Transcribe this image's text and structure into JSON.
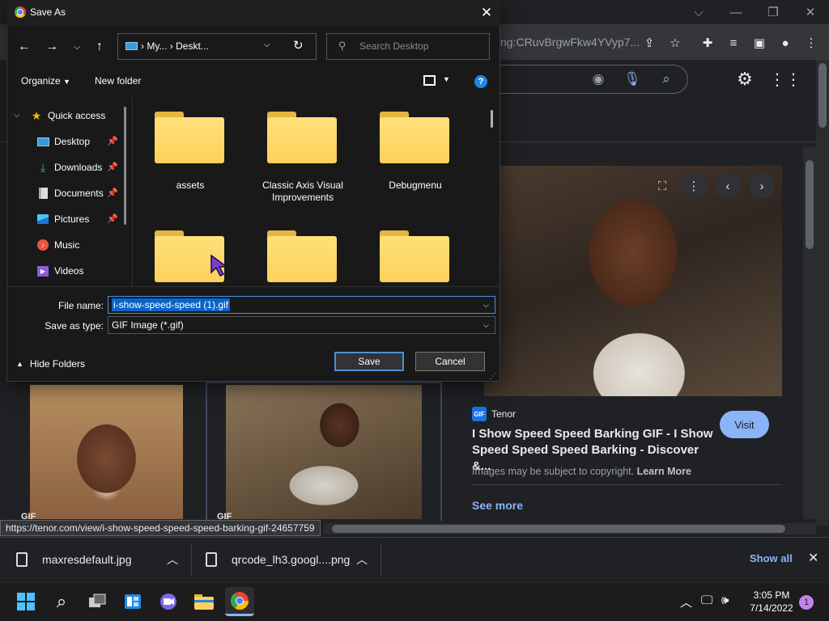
{
  "dialog": {
    "title": "Save As",
    "address_path": "My...  ›  Deskt...",
    "search_placeholder": "Search Desktop",
    "organize_label": "Organize",
    "new_folder_label": "New folder",
    "nav_items": [
      {
        "label": "Quick access"
      },
      {
        "label": "Desktop"
      },
      {
        "label": "Downloads"
      },
      {
        "label": "Documents"
      },
      {
        "label": "Pictures"
      },
      {
        "label": "Music"
      },
      {
        "label": "Videos"
      }
    ],
    "folders": [
      {
        "label": "assets"
      },
      {
        "label": "Classic Axis Visual Improvements"
      },
      {
        "label": "Debugmenu"
      },
      {
        "label": ""
      },
      {
        "label": ""
      },
      {
        "label": ""
      }
    ],
    "file_name_label": "File name:",
    "file_name_value": "i-show-speed-speed (1).gif",
    "save_as_type_label": "Save as type:",
    "save_as_type_value": "GIF Image (*.gif)",
    "hide_folders_label": "Hide Folders",
    "save_label": "Save",
    "cancel_label": "Cancel"
  },
  "browser": {
    "url_partial": "ng:CRuvBrgwFkw4YVyp7...",
    "status_url": "https://tenor.com/view/i-show-speed-speed-speed-barking-gif-24657759",
    "panel": {
      "source": "Tenor",
      "source_badge": "GIF",
      "title": "I Show Speed Speed Barking GIF - I Show Speed Speed Speed Barking - Discover &...",
      "visit_label": "Visit",
      "copyright_text": "Images may be subject to copyright.",
      "learn_more": "Learn More",
      "see_more": "See more"
    },
    "thumb_badge": "GIF"
  },
  "downloads": {
    "items": [
      {
        "name": "maxresdefault.jpg"
      },
      {
        "name": "qrcode_lh3.googl....png"
      }
    ],
    "show_all": "Show all"
  },
  "taskbar": {
    "time": "3:05 PM",
    "date": "7/14/2022",
    "notification_count": "1"
  },
  "colors": {
    "accent": "#8ab4f8",
    "folder": "#fcd15a",
    "selection": "#0a64c8"
  }
}
